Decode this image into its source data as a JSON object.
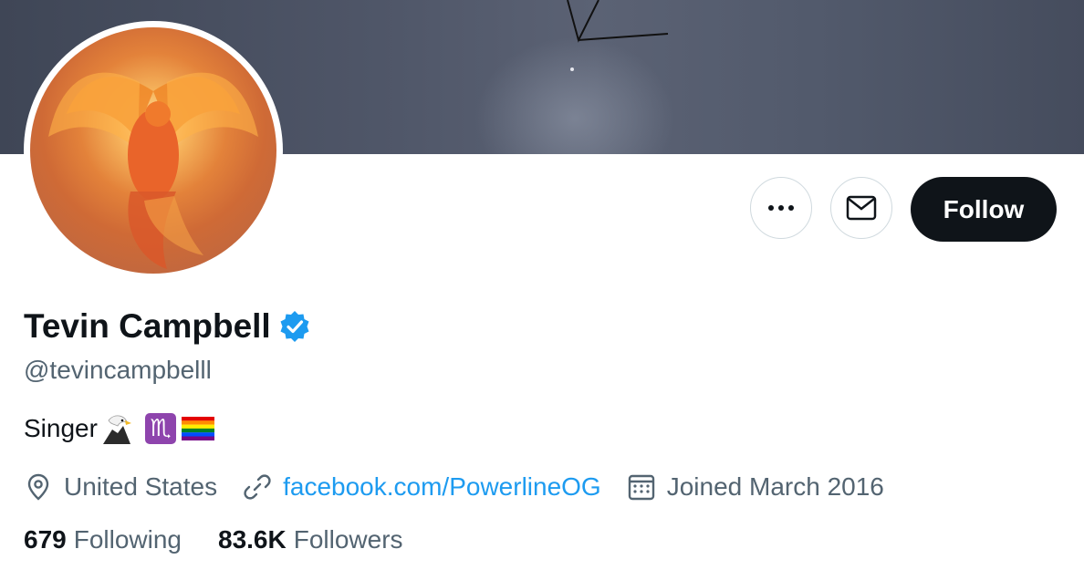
{
  "profile": {
    "name": "Tevin Campbell",
    "handle": "@tevincampbelll",
    "bio": "Singer",
    "location": "United States",
    "website": "facebook.com/PowerlineOG",
    "joined": "Joined March 2016"
  },
  "stats": {
    "following_count": "679",
    "following_label": "Following",
    "followers_count": "83.6K",
    "followers_label": "Followers"
  },
  "actions": {
    "follow_label": "Follow"
  },
  "icons": {
    "more": "more-icon",
    "message": "mail-icon",
    "verified": "verified-badge-icon",
    "location": "location-pin-icon",
    "link": "link-icon",
    "calendar": "calendar-icon",
    "bio_emojis": [
      "eagle-icon",
      "scorpio-icon",
      "rainbow-flag-icon"
    ]
  },
  "colors": {
    "accent": "#1d9bf0",
    "text": "#0f1419",
    "secondary": "#536471",
    "follow_bg": "#0f1419"
  }
}
